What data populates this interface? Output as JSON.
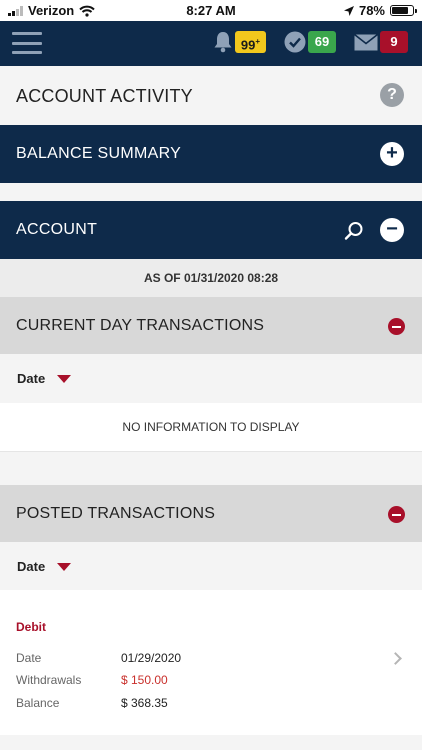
{
  "status_bar": {
    "carrier": "Verizon",
    "time": "8:27 AM",
    "battery": "78%",
    "battery_level": 0.78
  },
  "header": {
    "notifications_count": "99",
    "notifications_plus": "+",
    "approvals_count": "69",
    "messages_count": "9",
    "colors": {
      "navy": "#0e2a4a",
      "yellow": "#f2c81d",
      "green": "#3aa64c",
      "red": "#a8102a"
    }
  },
  "page": {
    "title": "ACCOUNT ACTIVITY",
    "help_icon": "question-circle-icon"
  },
  "balance_summary": {
    "label": "BALANCE SUMMARY",
    "toggle_icon": "plus-circle-icon"
  },
  "account": {
    "label": "ACCOUNT",
    "search_icon": "search-icon",
    "toggle_icon": "minus-circle-icon"
  },
  "as_of": "AS OF 01/31/2020 08:28",
  "current_day": {
    "title": "CURRENT DAY TRANSACTIONS",
    "sort_label": "Date",
    "empty_message": "NO INFORMATION TO DISPLAY"
  },
  "posted": {
    "title": "POSTED TRANSACTIONS",
    "sort_label": "Date",
    "transactions": [
      {
        "type": "Debit",
        "date_label": "Date",
        "date": "01/29/2020",
        "withdrawals_label": "Withdrawals",
        "withdrawals": "$ 150.00",
        "balance_label": "Balance",
        "balance": "$ 368.35"
      }
    ]
  }
}
